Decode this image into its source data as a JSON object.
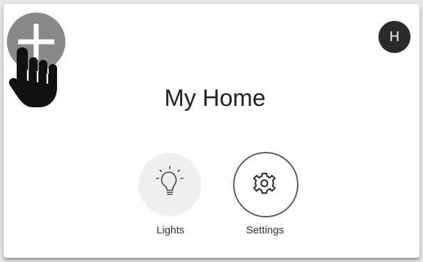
{
  "header": {
    "add_icon": "plus-icon",
    "avatar_initial": "H"
  },
  "main": {
    "title": "My Home",
    "tiles": [
      {
        "label": "Lights",
        "icon": "lightbulb-icon"
      },
      {
        "label": "Settings",
        "icon": "gear-icon"
      }
    ]
  },
  "overlay": {
    "pointer_icon": "hand-pointer-icon"
  },
  "colors": {
    "add_button": "#8a8a8a",
    "avatar": "#2a2a2a",
    "tile_active": "#eeeeee",
    "text": "#222222"
  }
}
